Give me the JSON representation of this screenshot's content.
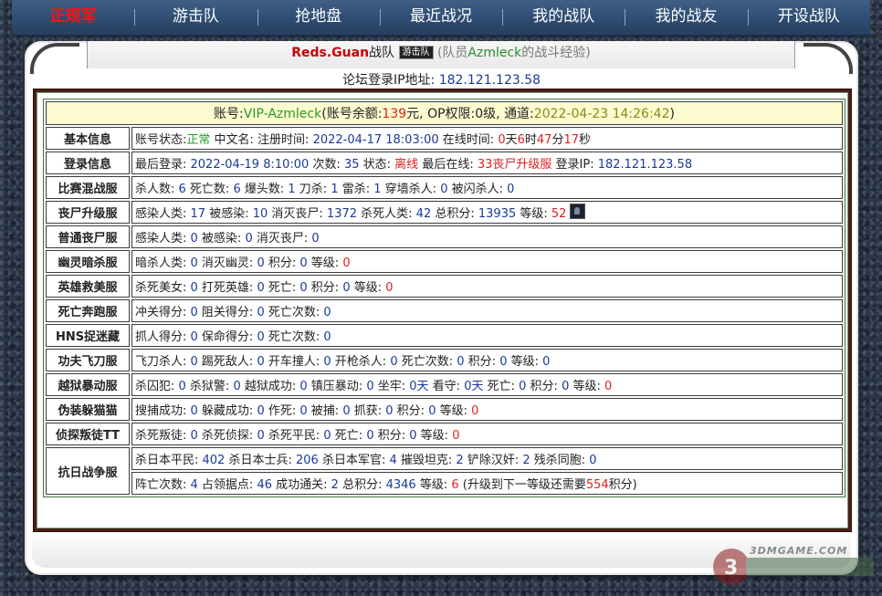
{
  "nav": {
    "items": [
      "正规军",
      "游击队",
      "抢地盘",
      "最近战况",
      "我的战队",
      "我的战友",
      "开设战队"
    ]
  },
  "header": {
    "team_name": "Reds.Guan",
    "team_suffix": "战队",
    "team_badge": "游击队",
    "member_note_open": "(队员",
    "member_name": "Azmleck",
    "member_note_close": "的战斗经验)",
    "ip_label": "论坛登录IP地址:",
    "ip_value": "182.121.123.58"
  },
  "account": {
    "prefix": "账号:",
    "name": "VIP-Azmleck",
    "balance_label": "(账号余额:",
    "balance": "139",
    "balance_unit": "元,",
    "op_label": "OP权限:",
    "op_value": "0级,",
    "channel_label": "通道:",
    "channel_value": "2022-04-23 14:26:42",
    "close": ")"
  },
  "rows": [
    {
      "label": "基本信息",
      "segments": [
        {
          "t": "账号状态:"
        },
        {
          "t": "正常",
          "c": "green"
        },
        {
          "t": " 中文名: 注册时间: "
        },
        {
          "t": "2022-04-17 18:03:00",
          "c": "blue"
        },
        {
          "t": " 在线时间: "
        },
        {
          "t": "0",
          "c": "red"
        },
        {
          "t": "天"
        },
        {
          "t": "6",
          "c": "red"
        },
        {
          "t": "时"
        },
        {
          "t": "47",
          "c": "red"
        },
        {
          "t": "分"
        },
        {
          "t": "17",
          "c": "red"
        },
        {
          "t": "秒"
        }
      ]
    },
    {
      "label": "登录信息",
      "segments": [
        {
          "t": "最后登录: "
        },
        {
          "t": "2022-04-19 8:10:00",
          "c": "blue"
        },
        {
          "t": " 次数: "
        },
        {
          "t": "35",
          "c": "blue"
        },
        {
          "t": " 状态: "
        },
        {
          "t": "离线",
          "c": "red"
        },
        {
          "t": " 最后在线: "
        },
        {
          "t": "33丧尸升级服",
          "c": "red"
        },
        {
          "t": " 登录IP: "
        },
        {
          "t": "182.121.123.58",
          "c": "blue"
        }
      ]
    },
    {
      "label": "比赛混战服",
      "segments": [
        {
          "t": "杀人数: "
        },
        {
          "t": "6",
          "c": "blue"
        },
        {
          "t": " 死亡数: "
        },
        {
          "t": "6",
          "c": "blue"
        },
        {
          "t": " 爆头数: "
        },
        {
          "t": "1",
          "c": "blue"
        },
        {
          "t": " 刀杀: "
        },
        {
          "t": "1",
          "c": "blue"
        },
        {
          "t": " 雷杀: "
        },
        {
          "t": "1",
          "c": "blue"
        },
        {
          "t": " 穿墙杀人: "
        },
        {
          "t": "0",
          "c": "blue"
        },
        {
          "t": " 被闪杀人: "
        },
        {
          "t": "0",
          "c": "blue"
        }
      ]
    },
    {
      "label": "丧尸升级服",
      "icon": true,
      "segments": [
        {
          "t": "感染人类: "
        },
        {
          "t": "17",
          "c": "blue"
        },
        {
          "t": " 被感染: "
        },
        {
          "t": "10",
          "c": "blue"
        },
        {
          "t": " 消灭丧尸: "
        },
        {
          "t": "1372",
          "c": "blue"
        },
        {
          "t": " 杀死人类: "
        },
        {
          "t": "42",
          "c": "blue"
        },
        {
          "t": " 总积分: "
        },
        {
          "t": "13935",
          "c": "blue"
        },
        {
          "t": " 等级: "
        },
        {
          "t": "52",
          "c": "red"
        }
      ]
    },
    {
      "label": "普通丧尸服",
      "segments": [
        {
          "t": "感染人类: "
        },
        {
          "t": "0",
          "c": "blue"
        },
        {
          "t": " 被感染: "
        },
        {
          "t": "0",
          "c": "blue"
        },
        {
          "t": " 消灭丧尸: "
        },
        {
          "t": "0",
          "c": "blue"
        }
      ]
    },
    {
      "label": "幽灵暗杀服",
      "segments": [
        {
          "t": "暗杀人类: "
        },
        {
          "t": "0",
          "c": "blue"
        },
        {
          "t": " 消灭幽灵: "
        },
        {
          "t": "0",
          "c": "blue"
        },
        {
          "t": " 积分: "
        },
        {
          "t": "0",
          "c": "blue"
        },
        {
          "t": " 等级: "
        },
        {
          "t": "0",
          "c": "red"
        }
      ]
    },
    {
      "label": "英雄救美服",
      "segments": [
        {
          "t": "杀死美女: "
        },
        {
          "t": "0",
          "c": "blue"
        },
        {
          "t": " 打死英雄: "
        },
        {
          "t": "0",
          "c": "blue"
        },
        {
          "t": " 死亡: "
        },
        {
          "t": "0",
          "c": "blue"
        },
        {
          "t": " 积分: "
        },
        {
          "t": "0",
          "c": "blue"
        },
        {
          "t": " 等级: "
        },
        {
          "t": "0",
          "c": "red"
        }
      ]
    },
    {
      "label": "死亡奔跑服",
      "segments": [
        {
          "t": "冲关得分: "
        },
        {
          "t": "0",
          "c": "blue"
        },
        {
          "t": " 阻关得分: "
        },
        {
          "t": "0",
          "c": "blue"
        },
        {
          "t": " 死亡次数: "
        },
        {
          "t": "0",
          "c": "blue"
        }
      ]
    },
    {
      "label": "HNS捉迷藏",
      "segments": [
        {
          "t": "抓人得分: "
        },
        {
          "t": "0",
          "c": "blue"
        },
        {
          "t": " 保命得分: "
        },
        {
          "t": "0",
          "c": "blue"
        },
        {
          "t": " 死亡次数: "
        },
        {
          "t": "0",
          "c": "blue"
        }
      ]
    },
    {
      "label": "功夫飞刀服",
      "segments": [
        {
          "t": "飞刀杀人: "
        },
        {
          "t": "0",
          "c": "blue"
        },
        {
          "t": " 踢死敌人: "
        },
        {
          "t": "0",
          "c": "blue"
        },
        {
          "t": " 开车撞人: "
        },
        {
          "t": "0",
          "c": "blue"
        },
        {
          "t": " 开枪杀人: "
        },
        {
          "t": "0",
          "c": "blue"
        },
        {
          "t": " 死亡次数: "
        },
        {
          "t": "0",
          "c": "blue"
        },
        {
          "t": " 积分: "
        },
        {
          "t": "0",
          "c": "blue"
        },
        {
          "t": " 等级: "
        },
        {
          "t": "0",
          "c": "blue"
        }
      ]
    },
    {
      "label": "越狱暴动服",
      "segments": [
        {
          "t": "杀囚犯: "
        },
        {
          "t": "0",
          "c": "blue"
        },
        {
          "t": " 杀狱警: "
        },
        {
          "t": "0",
          "c": "blue"
        },
        {
          "t": " 越狱成功: "
        },
        {
          "t": "0",
          "c": "blue"
        },
        {
          "t": " 镇压暴动: "
        },
        {
          "t": "0",
          "c": "blue"
        },
        {
          "t": " 坐牢: "
        },
        {
          "t": "0天",
          "c": "blue"
        },
        {
          "t": " 看守: "
        },
        {
          "t": "0天",
          "c": "blue"
        },
        {
          "t": " 死亡: "
        },
        {
          "t": "0",
          "c": "blue"
        },
        {
          "t": " 积分: "
        },
        {
          "t": "0",
          "c": "blue"
        },
        {
          "t": " 等级: "
        },
        {
          "t": "0",
          "c": "red"
        }
      ]
    },
    {
      "label": "伪装躲猫猫",
      "segments": [
        {
          "t": "搜捕成功: "
        },
        {
          "t": "0",
          "c": "blue"
        },
        {
          "t": " 躲藏成功: "
        },
        {
          "t": "0",
          "c": "blue"
        },
        {
          "t": " 作死: "
        },
        {
          "t": "0",
          "c": "blue"
        },
        {
          "t": " 被捕: "
        },
        {
          "t": "0",
          "c": "blue"
        },
        {
          "t": " 抓获: "
        },
        {
          "t": "0",
          "c": "blue"
        },
        {
          "t": " 积分: "
        },
        {
          "t": "0",
          "c": "blue"
        },
        {
          "t": " 等级: "
        },
        {
          "t": "0",
          "c": "red"
        }
      ]
    },
    {
      "label": "侦探叛徒TT",
      "segments": [
        {
          "t": "杀死叛徒: "
        },
        {
          "t": "0",
          "c": "blue"
        },
        {
          "t": " 杀死侦探: "
        },
        {
          "t": "0",
          "c": "blue"
        },
        {
          "t": " 杀死平民: "
        },
        {
          "t": "0",
          "c": "blue"
        },
        {
          "t": " 死亡: "
        },
        {
          "t": "0",
          "c": "blue"
        },
        {
          "t": " 积分: "
        },
        {
          "t": "0",
          "c": "blue"
        },
        {
          "t": " 等级: "
        },
        {
          "t": "0",
          "c": "red"
        }
      ]
    }
  ],
  "last_row": {
    "label": "抗日战争服",
    "line1": [
      {
        "t": "杀日本平民: "
      },
      {
        "t": "402",
        "c": "blue"
      },
      {
        "t": " 杀日本士兵: "
      },
      {
        "t": "206",
        "c": "blue"
      },
      {
        "t": " 杀日本军官: "
      },
      {
        "t": "4",
        "c": "blue"
      },
      {
        "t": " 摧毁坦克: "
      },
      {
        "t": "2",
        "c": "blue"
      },
      {
        "t": " 铲除汉奸: "
      },
      {
        "t": "2",
        "c": "blue"
      },
      {
        "t": " 残杀同胞: "
      },
      {
        "t": "0",
        "c": "blue"
      }
    ],
    "line2": [
      {
        "t": "阵亡次数: "
      },
      {
        "t": "4",
        "c": "blue"
      },
      {
        "t": " 占领据点: "
      },
      {
        "t": "46",
        "c": "blue"
      },
      {
        "t": " 成功通关: "
      },
      {
        "t": "2",
        "c": "blue"
      },
      {
        "t": " 总积分: "
      },
      {
        "t": "4346",
        "c": "blue"
      },
      {
        "t": " 等级: "
      },
      {
        "t": "6",
        "c": "red"
      },
      {
        "t": " (升级到下一等级还需要"
      },
      {
        "t": "554",
        "c": "red"
      },
      {
        "t": "积分)"
      }
    ]
  },
  "watermark": {
    "text": "3DMGAME.COM"
  },
  "colors": {
    "nav_bg": "#2f4d72",
    "brown": "#4a1f16",
    "label": "#6b0f5b",
    "account_bg": "#fdfbd0"
  }
}
